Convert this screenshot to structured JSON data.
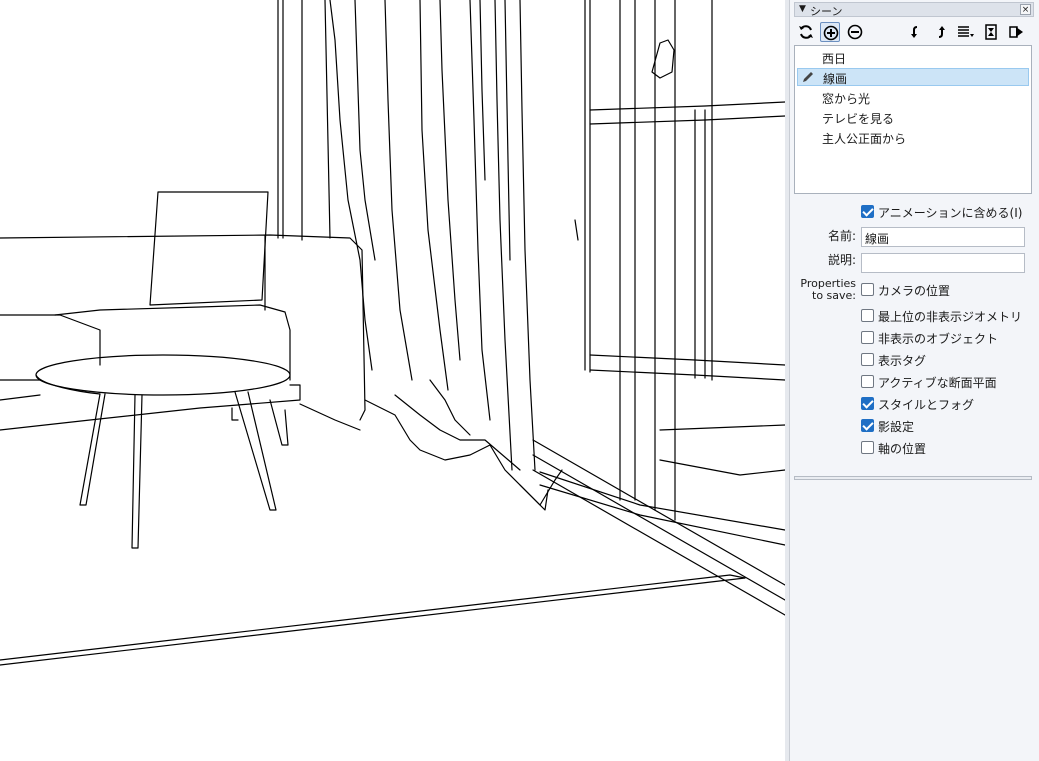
{
  "panel": {
    "title": "シーン",
    "toolbar": {
      "icons": [
        "refresh-icon",
        "add-scene-icon",
        "remove-scene-icon",
        "move-down-icon",
        "move-up-icon",
        "view-options-icon",
        "details-icon",
        "flyout-icon"
      ]
    },
    "scenes": [
      {
        "label": "西日",
        "selected": false
      },
      {
        "label": "線画",
        "selected": true
      },
      {
        "label": "窓から光",
        "selected": false
      },
      {
        "label": "テレビを見る",
        "selected": false
      },
      {
        "label": "主人公正面から",
        "selected": false
      }
    ],
    "include_in_animation": {
      "label": "アニメーションに含める(I)",
      "checked": true
    },
    "name_label": "名前:",
    "name_value": "線画",
    "description_label": "説明:",
    "description_value": "",
    "properties_label_line1": "Properties",
    "properties_label_line2": "to save:",
    "properties": [
      {
        "label": "カメラの位置",
        "checked": false
      },
      {
        "label": "最上位の非表示ジオメトリ",
        "checked": false
      },
      {
        "label": "非表示のオブジェクト",
        "checked": false
      },
      {
        "label": "表示タグ",
        "checked": false
      },
      {
        "label": "アクティブな断面平面",
        "checked": false
      },
      {
        "label": "スタイルとフォグ",
        "checked": true
      },
      {
        "label": "影設定",
        "checked": true
      },
      {
        "label": "軸の位置",
        "checked": false
      }
    ]
  },
  "colors": {
    "accent": "#1f6fc5",
    "selection": "#cce4f7",
    "panel_bg": "#f3f5f9"
  }
}
